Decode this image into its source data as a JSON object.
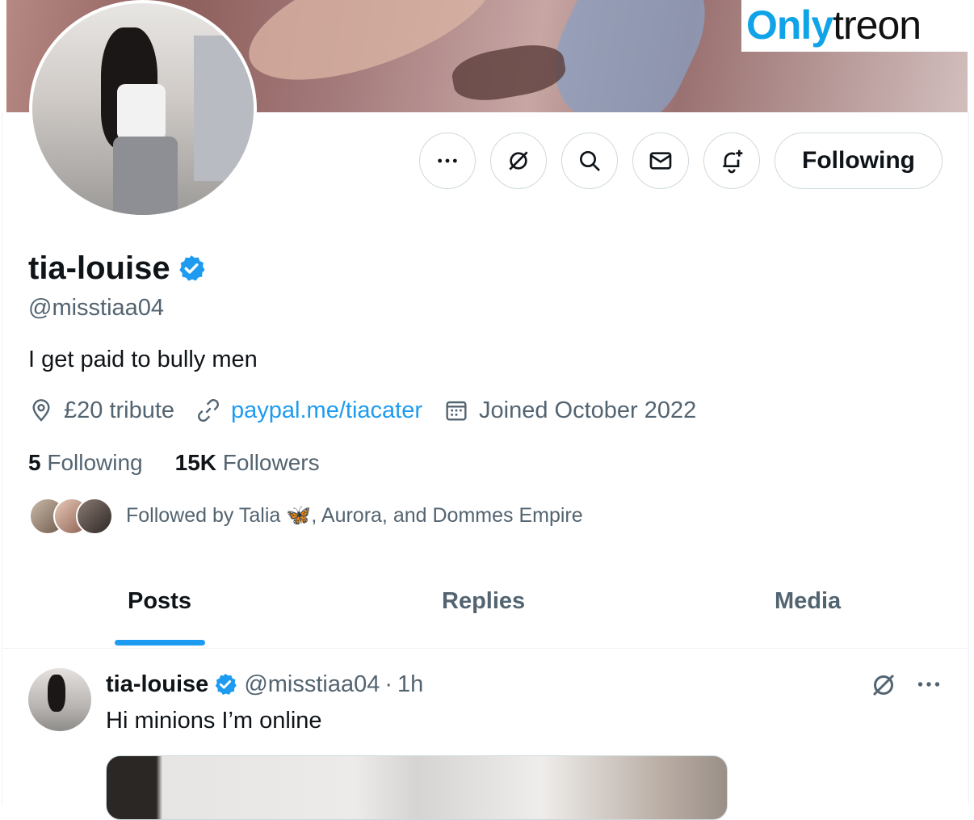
{
  "watermark": {
    "part1": "Only",
    "part2": "treon"
  },
  "profile": {
    "name": "tia-louise",
    "handle": "@misstiaa04",
    "bio": "I get paid to bully men",
    "location": "£20 tribute",
    "website": "paypal.me/tiacater",
    "joined": "Joined October 2022"
  },
  "actions": {
    "more_icon": "more-icon",
    "grok_icon": "grok-icon",
    "search_icon": "search-icon",
    "message_icon": "mail-icon",
    "notify_icon": "bell-plus-icon",
    "follow_label": "Following"
  },
  "stats": {
    "following_count": "5",
    "following_label": " Following",
    "followers_count": "15K",
    "followers_label": " Followers"
  },
  "followed_by": "Followed by Talia 🦋, Aurora, and Dommes Empire",
  "tabs": [
    "Posts",
    "Replies",
    "Media"
  ],
  "active_tab": "Posts",
  "post": {
    "name": "tia-louise",
    "handle": "@misstiaa04",
    "separator": "·",
    "time": "1h",
    "text": "Hi minions I’m online"
  },
  "colors": {
    "accent": "#1d9bf0",
    "secondary_text": "#536471",
    "border": "#cfd9de",
    "watermark_blue": "#11a3e8"
  }
}
